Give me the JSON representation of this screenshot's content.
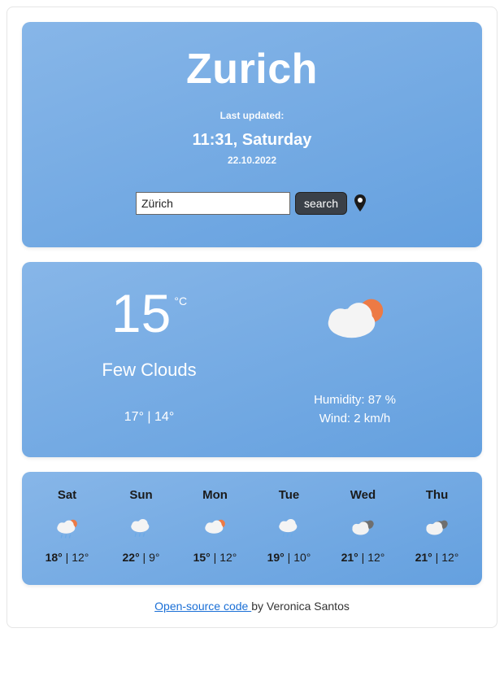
{
  "header": {
    "city": "Zurich",
    "last_updated_label": "Last updated:",
    "time_day": "11:31, Saturday",
    "date": "22.10.2022",
    "search_value": "Zürich",
    "search_button": "search"
  },
  "current": {
    "temp": "15",
    "unit": "°C",
    "condition": "Few Clouds",
    "high": "17°",
    "low": "14°",
    "humidity_label": "Humidity: 87 %",
    "wind_label": "Wind: 2 km/h",
    "icon": "few-clouds-icon"
  },
  "forecast": [
    {
      "day": "Sat",
      "hi": "18°",
      "lo": "12°",
      "icon": "rain-sun-icon"
    },
    {
      "day": "Sun",
      "hi": "22°",
      "lo": "9°",
      "icon": "rain-icon"
    },
    {
      "day": "Mon",
      "hi": "15°",
      "lo": "12°",
      "icon": "few-clouds-sm-icon"
    },
    {
      "day": "Tue",
      "hi": "19°",
      "lo": "10°",
      "icon": "rain-icon"
    },
    {
      "day": "Wed",
      "hi": "21°",
      "lo": "12°",
      "icon": "overcast-icon"
    },
    {
      "day": "Thu",
      "hi": "21°",
      "lo": "12°",
      "icon": "overcast-icon"
    }
  ],
  "footer": {
    "link_text": "Open-source code ",
    "byline": "by Veronica Santos"
  }
}
